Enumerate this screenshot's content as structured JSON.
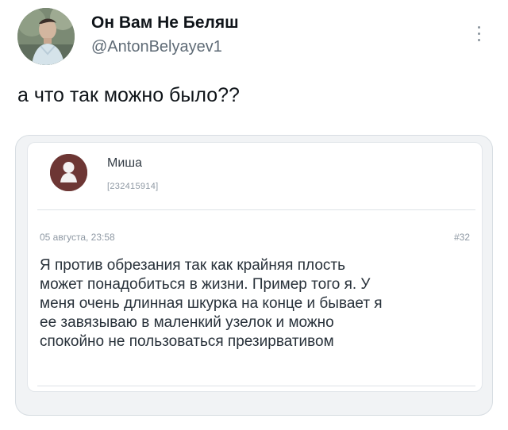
{
  "tweet": {
    "author_name": "Он Вам Не Беляш",
    "author_handle": "@AntonBelyayev1",
    "text": "а что так можно было??",
    "avatar_icon": "person-avatar-icon",
    "menu_icon": "more-vertical-icon"
  },
  "embedded_post": {
    "author_name": "Миша",
    "author_id": "[232415914]",
    "date": "05 августа, 23:58",
    "post_number": "#32",
    "body": "Я против обрезания так как крайняя плость\nможет понадобиться в жизни. Пример того я. У\nменя очень длинная шкурка на конце и бывает я\nее завязываю в маленкий узелок и можно\nспокойно не пользоваться презирвативом",
    "avatar_icon": "default-user-avatar-icon"
  },
  "colors": {
    "text_primary": "#0f1419",
    "text_secondary": "#5f6b76",
    "card_border": "#d7dde2",
    "post_avatar_bg": "#6d3634"
  }
}
